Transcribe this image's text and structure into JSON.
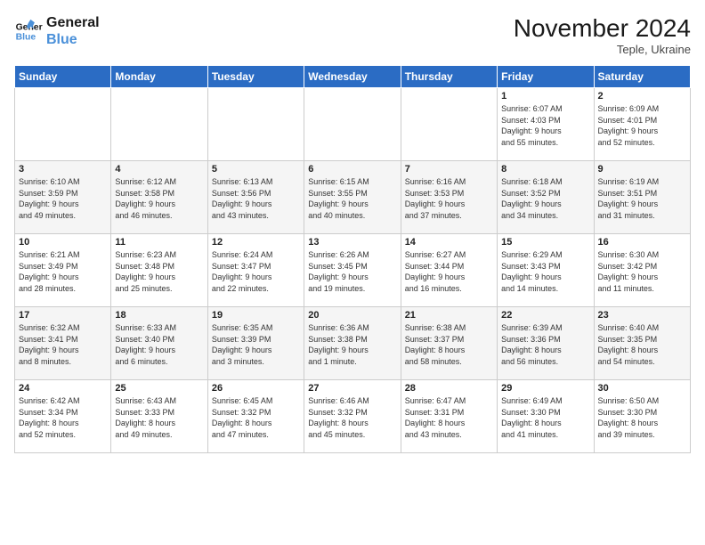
{
  "logo": {
    "line1": "General",
    "line2": "Blue"
  },
  "title": "November 2024",
  "location": "Teple, Ukraine",
  "days_header": [
    "Sunday",
    "Monday",
    "Tuesday",
    "Wednesday",
    "Thursday",
    "Friday",
    "Saturday"
  ],
  "weeks": [
    [
      {
        "day": "",
        "info": ""
      },
      {
        "day": "",
        "info": ""
      },
      {
        "day": "",
        "info": ""
      },
      {
        "day": "",
        "info": ""
      },
      {
        "day": "",
        "info": ""
      },
      {
        "day": "1",
        "info": "Sunrise: 6:07 AM\nSunset: 4:03 PM\nDaylight: 9 hours\nand 55 minutes."
      },
      {
        "day": "2",
        "info": "Sunrise: 6:09 AM\nSunset: 4:01 PM\nDaylight: 9 hours\nand 52 minutes."
      }
    ],
    [
      {
        "day": "3",
        "info": "Sunrise: 6:10 AM\nSunset: 3:59 PM\nDaylight: 9 hours\nand 49 minutes."
      },
      {
        "day": "4",
        "info": "Sunrise: 6:12 AM\nSunset: 3:58 PM\nDaylight: 9 hours\nand 46 minutes."
      },
      {
        "day": "5",
        "info": "Sunrise: 6:13 AM\nSunset: 3:56 PM\nDaylight: 9 hours\nand 43 minutes."
      },
      {
        "day": "6",
        "info": "Sunrise: 6:15 AM\nSunset: 3:55 PM\nDaylight: 9 hours\nand 40 minutes."
      },
      {
        "day": "7",
        "info": "Sunrise: 6:16 AM\nSunset: 3:53 PM\nDaylight: 9 hours\nand 37 minutes."
      },
      {
        "day": "8",
        "info": "Sunrise: 6:18 AM\nSunset: 3:52 PM\nDaylight: 9 hours\nand 34 minutes."
      },
      {
        "day": "9",
        "info": "Sunrise: 6:19 AM\nSunset: 3:51 PM\nDaylight: 9 hours\nand 31 minutes."
      }
    ],
    [
      {
        "day": "10",
        "info": "Sunrise: 6:21 AM\nSunset: 3:49 PM\nDaylight: 9 hours\nand 28 minutes."
      },
      {
        "day": "11",
        "info": "Sunrise: 6:23 AM\nSunset: 3:48 PM\nDaylight: 9 hours\nand 25 minutes."
      },
      {
        "day": "12",
        "info": "Sunrise: 6:24 AM\nSunset: 3:47 PM\nDaylight: 9 hours\nand 22 minutes."
      },
      {
        "day": "13",
        "info": "Sunrise: 6:26 AM\nSunset: 3:45 PM\nDaylight: 9 hours\nand 19 minutes."
      },
      {
        "day": "14",
        "info": "Sunrise: 6:27 AM\nSunset: 3:44 PM\nDaylight: 9 hours\nand 16 minutes."
      },
      {
        "day": "15",
        "info": "Sunrise: 6:29 AM\nSunset: 3:43 PM\nDaylight: 9 hours\nand 14 minutes."
      },
      {
        "day": "16",
        "info": "Sunrise: 6:30 AM\nSunset: 3:42 PM\nDaylight: 9 hours\nand 11 minutes."
      }
    ],
    [
      {
        "day": "17",
        "info": "Sunrise: 6:32 AM\nSunset: 3:41 PM\nDaylight: 9 hours\nand 8 minutes."
      },
      {
        "day": "18",
        "info": "Sunrise: 6:33 AM\nSunset: 3:40 PM\nDaylight: 9 hours\nand 6 minutes."
      },
      {
        "day": "19",
        "info": "Sunrise: 6:35 AM\nSunset: 3:39 PM\nDaylight: 9 hours\nand 3 minutes."
      },
      {
        "day": "20",
        "info": "Sunrise: 6:36 AM\nSunset: 3:38 PM\nDaylight: 9 hours\nand 1 minute."
      },
      {
        "day": "21",
        "info": "Sunrise: 6:38 AM\nSunset: 3:37 PM\nDaylight: 8 hours\nand 58 minutes."
      },
      {
        "day": "22",
        "info": "Sunrise: 6:39 AM\nSunset: 3:36 PM\nDaylight: 8 hours\nand 56 minutes."
      },
      {
        "day": "23",
        "info": "Sunrise: 6:40 AM\nSunset: 3:35 PM\nDaylight: 8 hours\nand 54 minutes."
      }
    ],
    [
      {
        "day": "24",
        "info": "Sunrise: 6:42 AM\nSunset: 3:34 PM\nDaylight: 8 hours\nand 52 minutes."
      },
      {
        "day": "25",
        "info": "Sunrise: 6:43 AM\nSunset: 3:33 PM\nDaylight: 8 hours\nand 49 minutes."
      },
      {
        "day": "26",
        "info": "Sunrise: 6:45 AM\nSunset: 3:32 PM\nDaylight: 8 hours\nand 47 minutes."
      },
      {
        "day": "27",
        "info": "Sunrise: 6:46 AM\nSunset: 3:32 PM\nDaylight: 8 hours\nand 45 minutes."
      },
      {
        "day": "28",
        "info": "Sunrise: 6:47 AM\nSunset: 3:31 PM\nDaylight: 8 hours\nand 43 minutes."
      },
      {
        "day": "29",
        "info": "Sunrise: 6:49 AM\nSunset: 3:30 PM\nDaylight: 8 hours\nand 41 minutes."
      },
      {
        "day": "30",
        "info": "Sunrise: 6:50 AM\nSunset: 3:30 PM\nDaylight: 8 hours\nand 39 minutes."
      }
    ]
  ]
}
